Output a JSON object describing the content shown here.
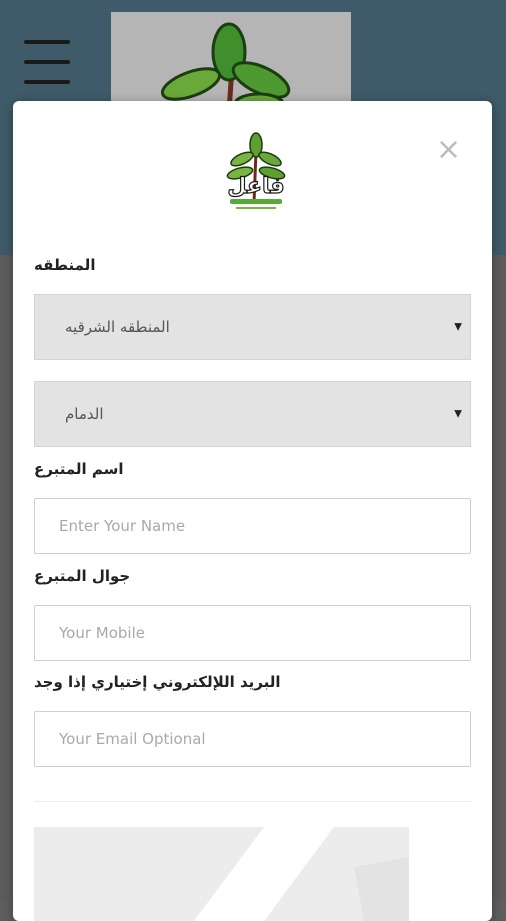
{
  "form": {
    "region_label": "المنطقه",
    "region_value": "المنطقه الشرقيه",
    "city_value": "الدمام",
    "name_label": "اسم المتبرع",
    "name_placeholder": "Enter Your Name",
    "mobile_label": "جوال المتبرع",
    "mobile_placeholder": "Your Mobile",
    "email_label": "البريد اللإلكتروني إختياري إذا وجد",
    "email_placeholder": "Your Email Optional"
  },
  "modal": {
    "close_glyph": "×",
    "logo_text": "فاعل"
  },
  "colors": {
    "header_bg": "#3f5a68",
    "select_bg": "#e3e3e3",
    "overlay": "#5c5c5c"
  },
  "icons": {
    "menu": "hamburger-icon",
    "close": "close-icon",
    "select_caret": "caret-down-icon"
  }
}
